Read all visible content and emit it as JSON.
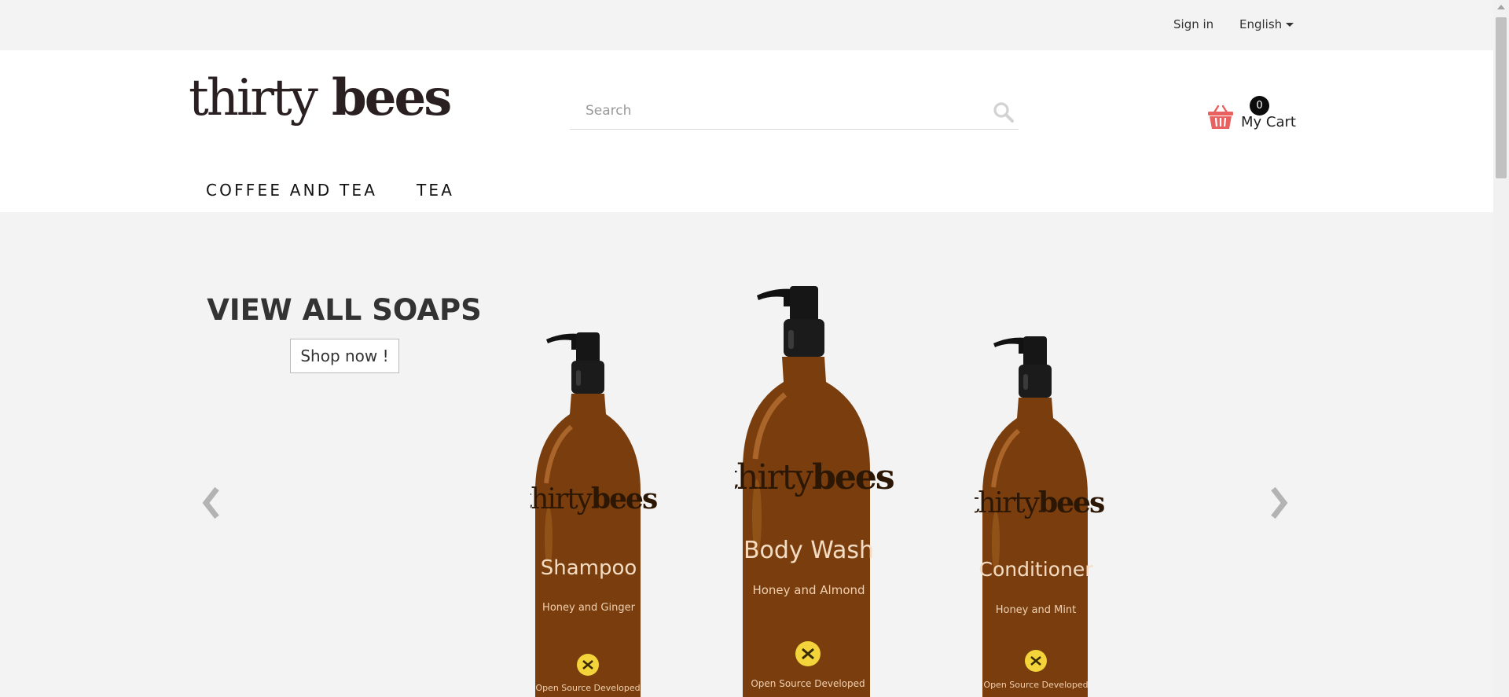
{
  "topbar": {
    "signin": "Sign in",
    "language": "English"
  },
  "logo": {
    "text_thirty": "thirty",
    "text_bees": "bees"
  },
  "search": {
    "placeholder": "Search",
    "value": ""
  },
  "cart": {
    "count": "0",
    "label": "My Cart"
  },
  "nav": {
    "items": [
      "COFFEE AND TEA",
      "TEA"
    ]
  },
  "slide": {
    "title": "VIEW ALL SOAPS",
    "cta": "Shop now !",
    "products": [
      {
        "brand_thirty": "thirty",
        "brand_bees": "bees",
        "name": "Shampoo",
        "variant": "Honey and Ginger",
        "footer": "Open Source Developed"
      },
      {
        "brand_thirty": "thirty",
        "brand_bees": "bees",
        "name": "Body Wash",
        "variant": "Honey and Almond",
        "footer": "Open Source Developed"
      },
      {
        "brand_thirty": "thirty",
        "brand_bees": "bees",
        "name": "Conditioner",
        "variant": "Honey and Mint",
        "footer": "Open Source Developed"
      }
    ]
  },
  "colors": {
    "accent": "#e8615f",
    "cart_badge": "#0b0b0b",
    "bottle_amber": "#7a3e0e",
    "badge_yellow": "#f3d43a"
  },
  "icons": {
    "search": "search-icon",
    "cart": "basket-icon",
    "prev": "chevron-left-icon",
    "next": "chevron-right-icon",
    "language": "caret-down-icon"
  }
}
